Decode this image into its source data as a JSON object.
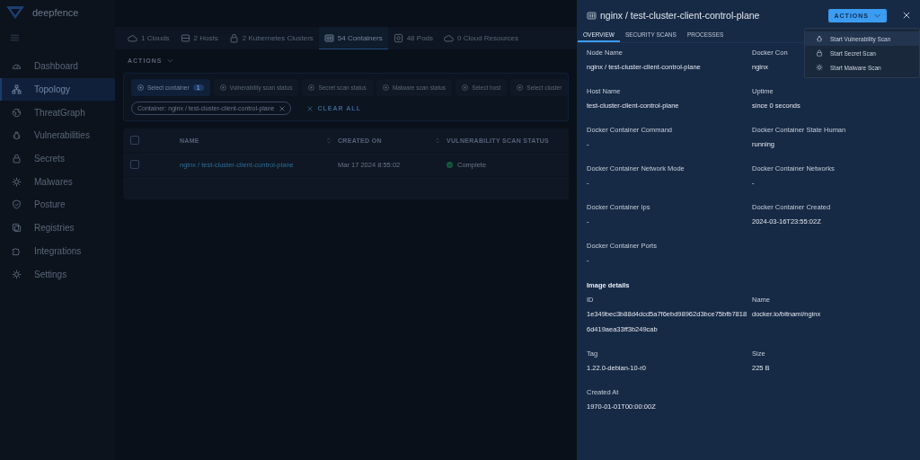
{
  "brand": {
    "name": "deepfence"
  },
  "sidebar": {
    "items": [
      {
        "label": "Dashboard",
        "selected": false
      },
      {
        "label": "Topology",
        "selected": true
      },
      {
        "label": "ThreatGraph",
        "selected": false
      },
      {
        "label": "Vulnerabilities",
        "selected": false
      },
      {
        "label": "Secrets",
        "selected": false
      },
      {
        "label": "Malwares",
        "selected": false
      },
      {
        "label": "Posture",
        "selected": false
      },
      {
        "label": "Registries",
        "selected": false
      },
      {
        "label": "Integrations",
        "selected": false
      },
      {
        "label": "Settings",
        "selected": false
      }
    ]
  },
  "resource_tabs": [
    {
      "label": "1 Clouds",
      "selected": false
    },
    {
      "label": "2 Hosts",
      "selected": false
    },
    {
      "label": "2 Kubernetes Clusters",
      "selected": false
    },
    {
      "label": "54 Containers",
      "selected": true
    },
    {
      "label": "48 Pods",
      "selected": false
    },
    {
      "label": "0 Cloud Resources",
      "selected": false
    }
  ],
  "actions_label": "ACTIONS",
  "filters": [
    {
      "label": "Select container",
      "count": "1",
      "selected": true
    },
    {
      "label": "Vulnerability scan status",
      "selected": false
    },
    {
      "label": "Secret scan status",
      "selected": false
    },
    {
      "label": "Malware scan status",
      "selected": false
    },
    {
      "label": "Select host",
      "selected": false
    },
    {
      "label": "Select cluster",
      "selected": false
    }
  ],
  "active_filters": [
    {
      "label": "Container: nginx / test-cluster-client-control-plane"
    }
  ],
  "clear_all": "CLEAR ALL",
  "table": {
    "all_checked": false,
    "columns": [
      {
        "label": "NAME",
        "sortable": true
      },
      {
        "label": "CREATED ON",
        "sortable": true
      },
      {
        "label": "VULNERABILITY SCAN STATUS",
        "sortable": false
      }
    ],
    "rows": [
      {
        "name": "nginx / test-cluster-client-control-plane",
        "created_on": "Mar 17 2024 8:55:02",
        "status": "Complete",
        "checked": false
      }
    ]
  },
  "drawer": {
    "title": "nginx / test-cluster-client-control-plane",
    "actions_button": "ACTIONS",
    "tabs": [
      {
        "label": "OVERVIEW",
        "selected": true
      },
      {
        "label": "SECURITY SCANS",
        "selected": false
      },
      {
        "label": "PROCESSES",
        "selected": false
      }
    ],
    "fields": [
      {
        "label": "Node Name",
        "value": "nginx / test-cluster-client-control-plane"
      },
      {
        "label": "Docker Con",
        "value": "nginx"
      },
      {
        "label": "Host Name",
        "value": "test-cluster-client-control-plane"
      },
      {
        "label": "Uptime",
        "value": "since 0 seconds"
      },
      {
        "label": "Docker Container Command",
        "value": "-"
      },
      {
        "label": "Docker Container State Human",
        "value": "running"
      },
      {
        "label": "Docker Container Network Mode",
        "value": "-"
      },
      {
        "label": "Docker Container Networks",
        "value": "-"
      },
      {
        "label": "Docker Container Ips",
        "value": "-"
      },
      {
        "label": "Docker Container Created",
        "value": "2024-03-16T23:55:02Z"
      },
      {
        "label": "Docker Container Ports",
        "value": "-"
      }
    ],
    "image_section": "Image details",
    "image_fields": [
      {
        "label": "ID",
        "value": "1e349bec3b88d4dcd5a7f6ebd98962d3bce75bfb78186d419aea33ff3b249cab"
      },
      {
        "label": "Name",
        "value": "docker.io/bitnami/nginx"
      },
      {
        "label": "Tag",
        "value": "1.22.0-debian-10-r0"
      },
      {
        "label": "Size",
        "value": "225 B"
      },
      {
        "label": "Created At",
        "value": "1970-01-01T00:00:00Z"
      }
    ],
    "menu": [
      {
        "label": "Start Vulnerability Scan",
        "selected": true
      },
      {
        "label": "Start Secret Scan",
        "selected": false
      },
      {
        "label": "Start Malware Scan",
        "selected": false
      }
    ]
  }
}
